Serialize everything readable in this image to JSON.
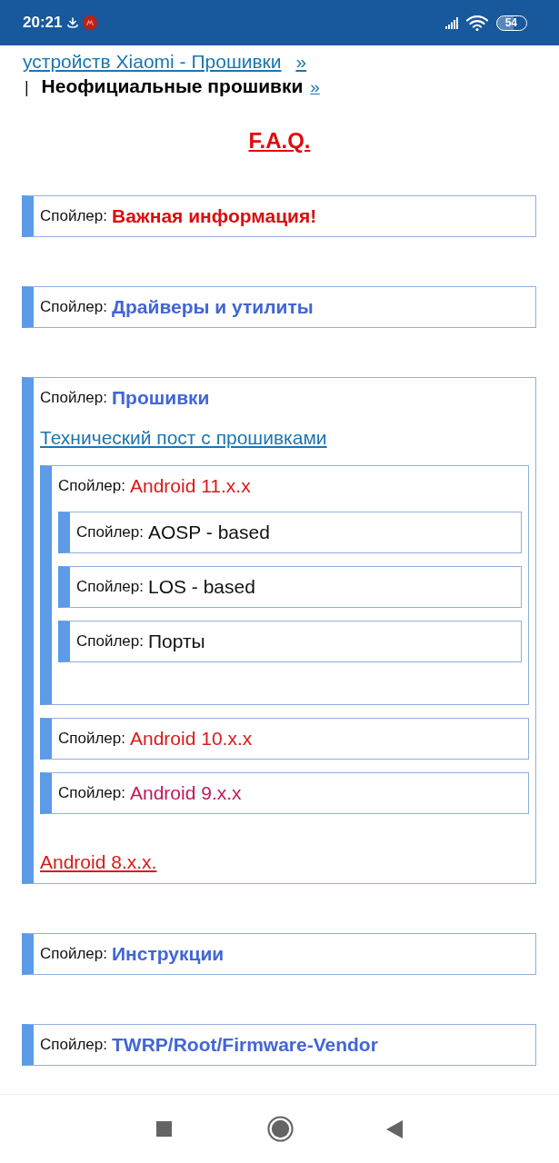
{
  "status_bar": {
    "time": "20:21",
    "battery": "54"
  },
  "breadcrumb": {
    "link": "устройств Xiaomi - Прошивки",
    "link_arrow": "»",
    "separator": "|",
    "current": "Неофициальные прошивки",
    "current_arrow": "»"
  },
  "heading": "F.A.Q.",
  "spoilers": [
    {
      "kind": "spoiler",
      "label": "Спойлер:",
      "title": "Важная информация!",
      "color": "#d90f0f",
      "bold": true
    },
    {
      "kind": "spoiler",
      "label": "Спойлер:",
      "title": "Драйверы и утилиты",
      "color": "#4166d5",
      "bold": true
    },
    {
      "kind": "spoiler",
      "label": "Спойлер:",
      "title": "Прошивки",
      "color": "#4166d5",
      "bold": true,
      "children": [
        {
          "kind": "link",
          "text": "Технический пост с прошивками",
          "color": "#1a76b0"
        },
        {
          "kind": "spoiler",
          "label": "Спойлер:",
          "title": "Android 11.x.x",
          "color": "#d91a1a",
          "bold": false,
          "children": [
            {
              "kind": "spoiler",
              "label": "Спойлер:",
              "title": "AOSP - based",
              "color": "#111111",
              "bold": false
            },
            {
              "kind": "spoiler",
              "label": "Спойлер:",
              "title": "LOS - based",
              "color": "#111111",
              "bold": false
            },
            {
              "kind": "spoiler",
              "label": "Спойлер:",
              "title": "Порты",
              "color": "#111111",
              "bold": false
            }
          ]
        },
        {
          "kind": "spoiler",
          "label": "Спойлер:",
          "title": "Android 10.x.x",
          "color": "#d91a1a",
          "bold": false
        },
        {
          "kind": "spoiler",
          "label": "Спойлер:",
          "title": "Android 9.x.x",
          "color": "#c2185b",
          "bold": false
        },
        {
          "kind": "link",
          "text": "Android 8.x.x.",
          "color": "#d91a1a"
        }
      ]
    },
    {
      "kind": "spoiler",
      "label": "Спойлер:",
      "title": "Инструкции",
      "color": "#4166d5",
      "bold": true
    },
    {
      "kind": "spoiler",
      "label": "Спойлер:",
      "title": "TWRP/Root/Firmware-Vendor",
      "color": "#4166d5",
      "bold": true
    }
  ]
}
